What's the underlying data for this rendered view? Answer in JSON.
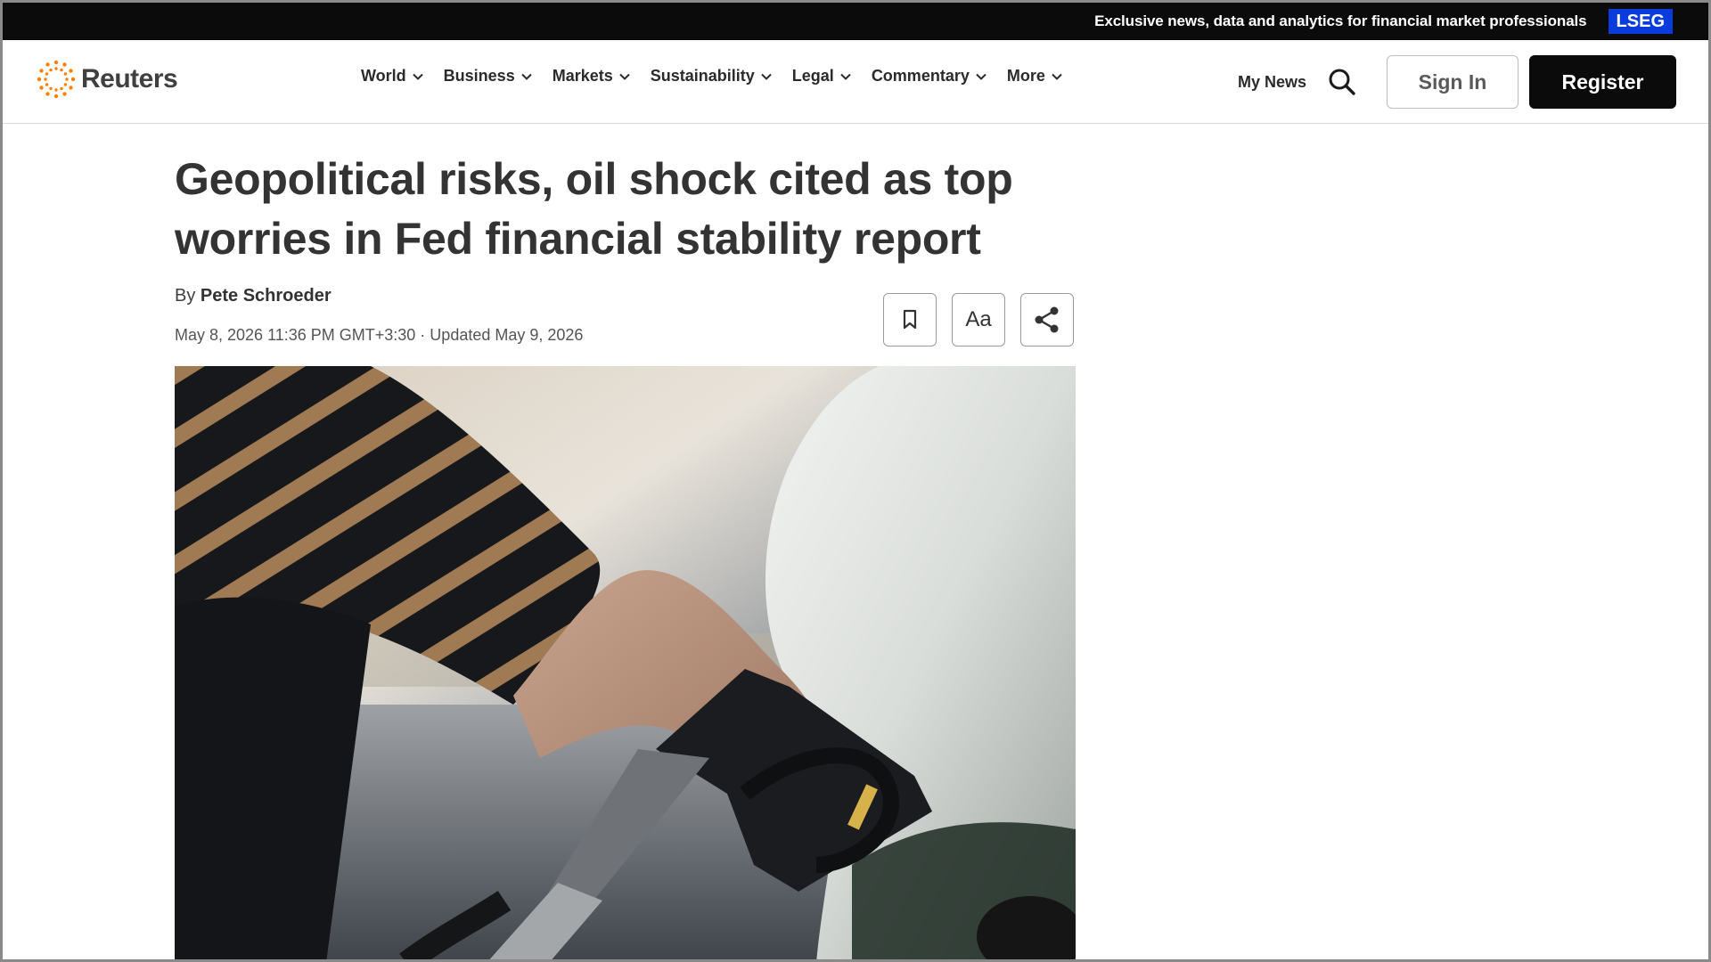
{
  "banner": {
    "text": "Exclusive news, data and analytics for financial market professionals",
    "badge": "LSEG",
    "badge_color": "#0a3bdc"
  },
  "header": {
    "logo_text": "Reuters",
    "logo_color": "#ff8000",
    "nav": [
      "World",
      "Business",
      "Markets",
      "Sustainability",
      "Legal",
      "Commentary",
      "More"
    ],
    "my_news": "My News",
    "sign_in": "Sign In",
    "register": "Register"
  },
  "article": {
    "headline": "Geopolitical risks, oil shock cited as top worries in Fed financial stability report",
    "byline_prefix": "By",
    "author": "Pete Schroeder",
    "dateline": "May 8, 2026 11:36 PM GMT+3:30 · Updated May 9, 2026",
    "tools": {
      "save_icon": "bookmark-icon",
      "text_size_label": "Aa",
      "share_icon": "share-icon"
    },
    "image_description_icon": "photo-fuel-pump"
  }
}
